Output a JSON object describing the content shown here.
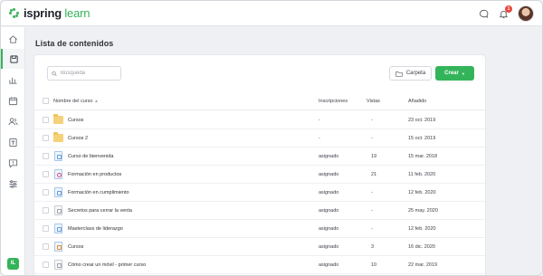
{
  "app": {
    "logo_brand": "ispring",
    "logo_product": "learn",
    "notification_count": "1"
  },
  "colors": {
    "accent": "#34b45a",
    "badge": "#e8473d",
    "folder": "#f5d27a"
  },
  "sidebar": {
    "items": [
      {
        "icon": "home-icon"
      },
      {
        "icon": "content-icon",
        "active": true
      },
      {
        "icon": "reports-icon"
      },
      {
        "icon": "calendar-icon"
      },
      {
        "icon": "users-icon"
      },
      {
        "icon": "assignments-icon"
      },
      {
        "icon": "chat-icon"
      },
      {
        "icon": "settings-icon"
      }
    ],
    "bottom_badge": "IL"
  },
  "page": {
    "title": "Lista de contenidos"
  },
  "toolbar": {
    "search_placeholder": "Búsqueda",
    "folder_label": "Carpeta",
    "create_label": "Crear"
  },
  "table": {
    "headers": {
      "name": "Nombre del curso",
      "enrollments": "Inscripciones",
      "views": "Vistas",
      "added": "Añadido"
    },
    "rows": [
      {
        "icon": "folder",
        "name": "Cursos",
        "enrollments": "-",
        "views": "-",
        "added": "23 oct. 2019"
      },
      {
        "icon": "folder",
        "name": "Cursos 2",
        "enrollments": "-",
        "views": "-",
        "added": "15 oct. 2019"
      },
      {
        "icon": "doc-blue",
        "name": "Curso de bienvenida",
        "enrollments": "asignado",
        "views": "19",
        "added": "15 mar. 2018"
      },
      {
        "icon": "doc-red",
        "name": "Formación en productos",
        "enrollments": "asignado",
        "views": "21",
        "added": "11 feb. 2020"
      },
      {
        "icon": "doc-blue",
        "name": "Formación en cumplimiento",
        "enrollments": "asignado",
        "views": "-",
        "added": "12 feb. 2020"
      },
      {
        "icon": "doc-plain",
        "name": "Secretos para cerrar la venta",
        "enrollments": "asignado",
        "views": "-",
        "added": "25 may. 2020"
      },
      {
        "icon": "doc-blue",
        "name": "Masterclass de liderazgo",
        "enrollments": "asignado",
        "views": "-",
        "added": "12 feb. 2020"
      },
      {
        "icon": "doc-orange",
        "name": "Cursos",
        "enrollments": "asignado",
        "views": "3",
        "added": "16 dic. 2020"
      },
      {
        "icon": "doc-plain",
        "name": "Cómo crear un móvil - primer curso",
        "enrollments": "asignado",
        "views": "10",
        "added": "22 mar. 2019"
      }
    ]
  }
}
